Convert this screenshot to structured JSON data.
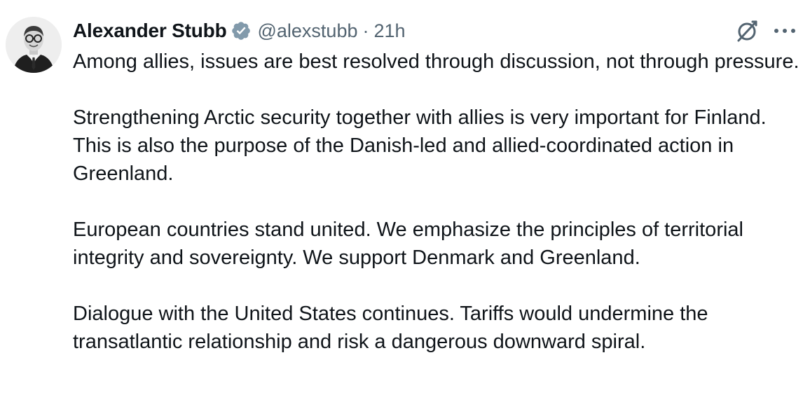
{
  "author": {
    "display_name": "Alexander Stubb",
    "handle": "@alexstubb",
    "separator": "·",
    "timestamp": "21h",
    "verified": true,
    "verified_badge_color": "#829aab",
    "avatar_icon": "profile-photo"
  },
  "actions": {
    "grok_icon": "grok-icon",
    "more_icon": "more-horizontal-icon"
  },
  "tweet": {
    "paragraphs": [
      "Among allies, issues are best resolved through discussion, not through pressure.",
      "Strengthening Arctic security together with allies is very important for Finland. This is also the purpose of the Danish-led and allied-coordinated action in Greenland.",
      "European countries stand united. We emphasize the principles of territorial integrity and sovereignty. We support Denmark and Greenland.",
      "Dialogue with the United States continues. Tariffs would undermine the transatlantic relationship and risk a dangerous downward spiral."
    ]
  },
  "colors": {
    "text_primary": "#0f1419",
    "text_secondary": "#536471",
    "background": "#ffffff"
  }
}
